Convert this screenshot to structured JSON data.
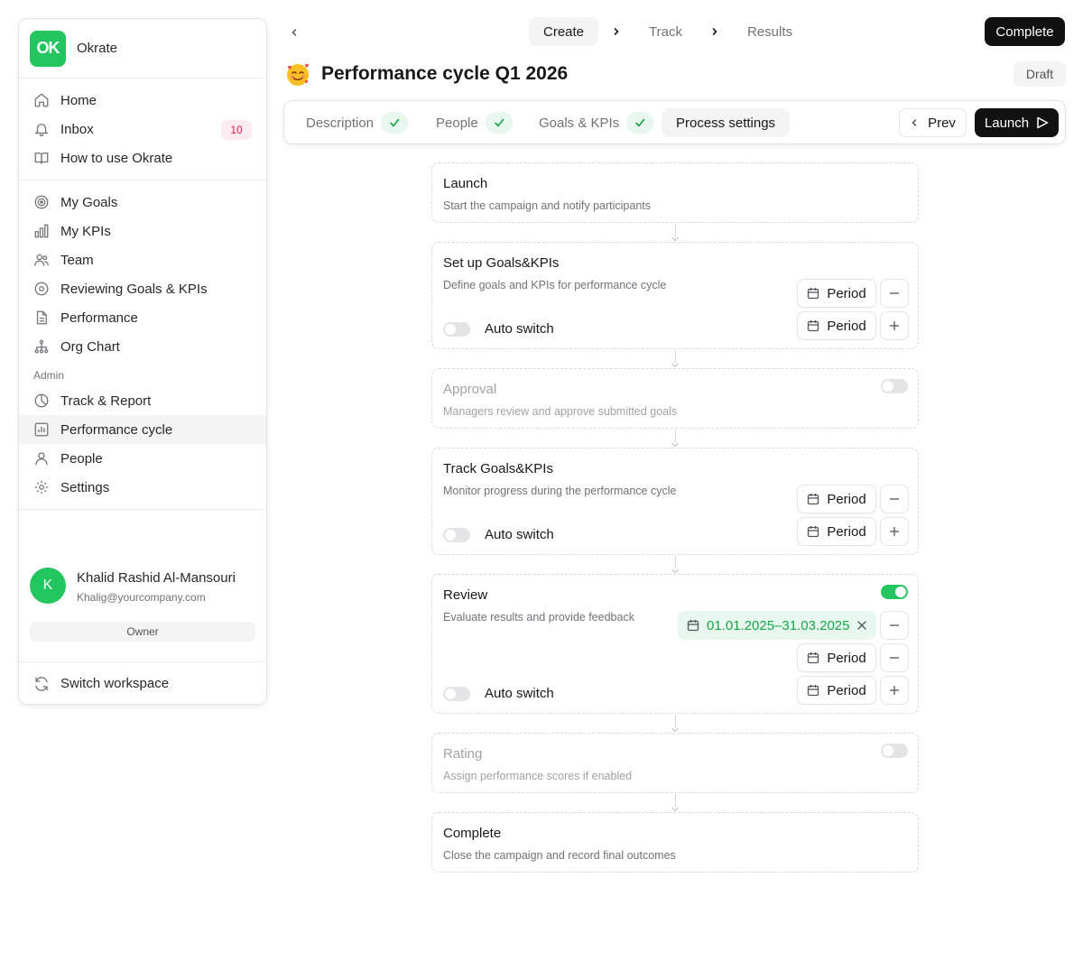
{
  "workspace": {
    "logo": "OK",
    "name": "Okrate"
  },
  "nav_main": [
    {
      "label": "Home",
      "icon": "home-icon"
    },
    {
      "label": "Inbox",
      "icon": "bell-icon",
      "badge": "10"
    },
    {
      "label": "How to use Okrate",
      "icon": "book-icon"
    }
  ],
  "nav_work": [
    {
      "label": "My Goals",
      "icon": "target-icon"
    },
    {
      "label": "My KPIs",
      "icon": "bar-chart-icon"
    },
    {
      "label": "Team",
      "icon": "users-icon"
    },
    {
      "label": "Reviewing Goals & KPIs",
      "icon": "eye-icon"
    },
    {
      "label": "Performance",
      "icon": "document-icon"
    },
    {
      "label": "Org Chart",
      "icon": "org-chart-icon"
    }
  ],
  "admin": {
    "label": "Admin",
    "items": [
      {
        "label": "Track & Report",
        "icon": "pie-chart-icon"
      },
      {
        "label": "Performance cycle",
        "icon": "chart-square-icon",
        "active": true
      },
      {
        "label": "People",
        "icon": "user-icon"
      },
      {
        "label": "Settings",
        "icon": "gear-icon"
      }
    ]
  },
  "user": {
    "initial": "K",
    "name": "Khalid Rashid Al-Mansouri",
    "email": "Khalig@yourcompany.com",
    "role": "Owner"
  },
  "switch_workspace": "Switch workspace",
  "steps": [
    "Create",
    "Track",
    "Results"
  ],
  "current_step": "Create",
  "complete_label": "Complete",
  "page": {
    "title": "Performance cycle Q1 2026",
    "status": "Draft",
    "emoji": "smiling-face-with-hearts"
  },
  "tabs": [
    {
      "label": "Description",
      "done": true
    },
    {
      "label": "People",
      "done": true
    },
    {
      "label": "Goals & KPIs",
      "done": true
    },
    {
      "label": "Process settings",
      "active": true
    }
  ],
  "prev_label": "Prev",
  "launch_label": "Launch",
  "stages": [
    {
      "title": "Launch",
      "desc": "Start the campaign and notify participants"
    },
    {
      "title": "Set up Goals&KPIs",
      "desc": "Define goals and KPIs for performance cycle",
      "auto_switch": "Auto switch",
      "auto_switch_on": false,
      "period_label": "Period"
    },
    {
      "title": "Approval",
      "desc": "Managers review and approve submitted goals",
      "enabled": false
    },
    {
      "title": "Track Goals&KPIs",
      "desc": "Monitor progress during the performance cycle",
      "auto_switch": "Auto switch",
      "auto_switch_on": false,
      "period_label": "Period"
    },
    {
      "title": "Review",
      "desc": "Evaluate results and provide feedback",
      "enabled": true,
      "date_range": "01.01.2025–31.03.2025",
      "auto_switch": "Auto switch",
      "auto_switch_on": false,
      "period_label": "Period"
    },
    {
      "title": "Rating",
      "desc": "Assign performance scores if enabled",
      "enabled": false
    },
    {
      "title": "Complete",
      "desc": "Close the campaign and record final outcomes"
    }
  ],
  "colors": {
    "accent": "#22c55e",
    "accent_bg": "#e8f8ee",
    "dark": "#111111",
    "badge_text": "#e11d48",
    "badge_bg": "#fdecef"
  }
}
